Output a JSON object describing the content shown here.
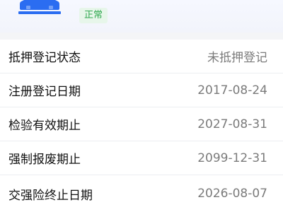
{
  "header": {
    "status": "正常",
    "car_icon": "car-icon",
    "accent": "#2b6df1"
  },
  "details": {
    "rows": [
      {
        "label": "抵押登记状态",
        "value": "未抵押登记"
      },
      {
        "label": "注册登记日期",
        "value": "2017-08-24"
      },
      {
        "label": "检验有效期止",
        "value": "2027-08-31"
      },
      {
        "label": "强制报废期止",
        "value": "2099-12-31"
      },
      {
        "label": "交强险终止日期",
        "value": "2026-08-07"
      }
    ]
  }
}
